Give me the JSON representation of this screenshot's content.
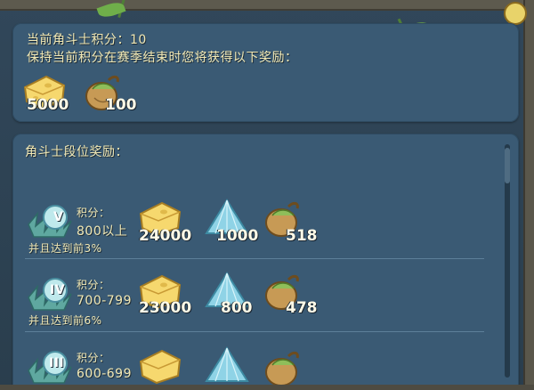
{
  "header": {
    "score_line": "当前角斗士积分：10",
    "keep_line": "保持当前积分在赛季结束时您将获得以下奖励："
  },
  "current_rewards": [
    {
      "icon": "cheese-icon",
      "amount": "5000"
    },
    {
      "icon": "seed-pouch-icon",
      "amount": "100"
    }
  ],
  "tier_section": {
    "title": "角斗士段位奖励："
  },
  "tiers": [
    {
      "badge": "V",
      "score_label": "积分：",
      "score_range": "800以上",
      "condition": "并且达到前3%",
      "rewards": [
        {
          "icon": "cheese-icon",
          "amount": "24000"
        },
        {
          "icon": "crystal-icon",
          "amount": "1000"
        },
        {
          "icon": "seed-pouch-icon",
          "amount": "518"
        }
      ]
    },
    {
      "badge": "IV",
      "score_label": "积分：",
      "score_range": "700-799",
      "condition": "并且达到前6%",
      "rewards": [
        {
          "icon": "cheese-icon",
          "amount": "23000"
        },
        {
          "icon": "crystal-icon",
          "amount": "800"
        },
        {
          "icon": "seed-pouch-icon",
          "amount": "478"
        }
      ]
    },
    {
      "badge": "III",
      "score_label": "积分：",
      "score_range": "600-699",
      "condition": "",
      "rewards": [
        {
          "icon": "cheese-icon",
          "amount": ""
        },
        {
          "icon": "crystal-icon",
          "amount": ""
        },
        {
          "icon": "seed-pouch-icon",
          "amount": ""
        }
      ]
    }
  ],
  "colors": {
    "panel": "#3a5a74",
    "text_gold": "#f2e9b5",
    "cheese": "#f4d56a",
    "crystal": "#8fd3e6",
    "pouch": "#c8a05a",
    "badge_leaf": "#5fa8a0"
  }
}
